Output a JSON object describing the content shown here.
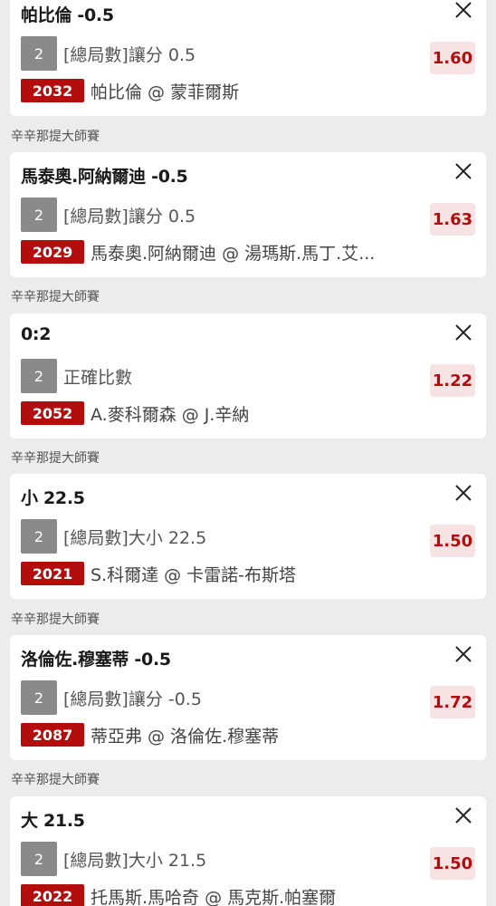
{
  "bets": [
    {
      "league": "",
      "selection": "帕比倫 -0.5",
      "legs": "2",
      "market": "[總局數]讓分 0.5",
      "match_id": "2032",
      "match": "帕比倫 @ 蒙菲爾斯",
      "odds": "1.60"
    },
    {
      "league": "辛辛那提大師賽",
      "selection": "馬泰奧.阿納爾迪 -0.5",
      "legs": "2",
      "market": "[總局數]讓分 0.5",
      "match_id": "2029",
      "match": "馬泰奧.阿納爾迪 @ 湯瑪斯.馬丁.艾...",
      "odds": "1.63"
    },
    {
      "league": "辛辛那提大師賽",
      "selection": "0:2",
      "legs": "2",
      "market": "正確比數",
      "match_id": "2052",
      "match": "A.麥科爾森 @ J.辛納",
      "odds": "1.22"
    },
    {
      "league": "辛辛那提大師賽",
      "selection": "小 22.5",
      "legs": "2",
      "market": "[總局數]大小 22.5",
      "match_id": "2021",
      "match": "S.科爾達 @ 卡雷諾-布斯塔",
      "odds": "1.50"
    },
    {
      "league": "辛辛那提大師賽",
      "selection": "洛倫佐.穆塞蒂 -0.5",
      "legs": "2",
      "market": "[總局數]讓分 -0.5",
      "match_id": "2087",
      "match": "蒂亞弗 @ 洛倫佐.穆塞蒂",
      "odds": "1.72"
    },
    {
      "league": "辛辛那提大師賽",
      "selection": "大 21.5",
      "legs": "2",
      "market": "[總局數]大小 21.5",
      "match_id": "2022",
      "match": "托馬斯.馬哈奇 @ 馬克斯.帕塞爾",
      "odds": "1.50"
    }
  ]
}
